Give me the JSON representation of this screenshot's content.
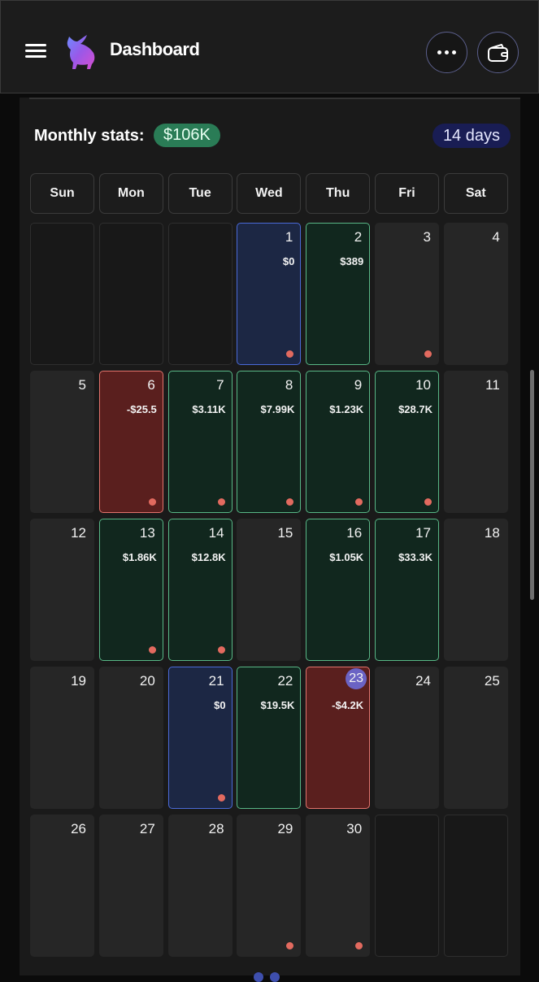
{
  "header": {
    "title": "Dashboard",
    "icons": {
      "menu": "hamburger-icon",
      "logo": "bull-logo",
      "more": "more-horizontal-icon",
      "wallet": "wallet-icon"
    }
  },
  "stats": {
    "label": "Monthly stats:",
    "total": "$106K",
    "days": "14 days"
  },
  "colors": {
    "profit": "#58b786",
    "loss": "#e3736c",
    "neutral": "#4a6ad8",
    "stats_badge": "#2a7c56",
    "days_badge": "#191d54",
    "today_circle": "#6b63c4",
    "marker_dot": "#e26a5f"
  },
  "calendar": {
    "weekdays": [
      "Sun",
      "Mon",
      "Tue",
      "Wed",
      "Thu",
      "Fri",
      "Sat"
    ],
    "cells": [
      {
        "day": "",
        "status": "empty",
        "amount": "",
        "dot": false
      },
      {
        "day": "",
        "status": "empty",
        "amount": "",
        "dot": false
      },
      {
        "day": "",
        "status": "empty",
        "amount": "",
        "dot": false
      },
      {
        "day": "1",
        "status": "neutral",
        "amount": "$0",
        "dot": true
      },
      {
        "day": "2",
        "status": "profit",
        "amount": "$389",
        "dot": false
      },
      {
        "day": "3",
        "status": "none",
        "amount": "",
        "dot": true
      },
      {
        "day": "4",
        "status": "none",
        "amount": "",
        "dot": false
      },
      {
        "day": "5",
        "status": "none",
        "amount": "",
        "dot": false
      },
      {
        "day": "6",
        "status": "loss",
        "amount": "-$25.5",
        "dot": true
      },
      {
        "day": "7",
        "status": "profit",
        "amount": "$3.11K",
        "dot": true
      },
      {
        "day": "8",
        "status": "profit",
        "amount": "$7.99K",
        "dot": true
      },
      {
        "day": "9",
        "status": "profit",
        "amount": "$1.23K",
        "dot": true
      },
      {
        "day": "10",
        "status": "profit",
        "amount": "$28.7K",
        "dot": true
      },
      {
        "day": "11",
        "status": "none",
        "amount": "",
        "dot": false
      },
      {
        "day": "12",
        "status": "none",
        "amount": "",
        "dot": false
      },
      {
        "day": "13",
        "status": "profit",
        "amount": "$1.86K",
        "dot": true
      },
      {
        "day": "14",
        "status": "profit",
        "amount": "$12.8K",
        "dot": true
      },
      {
        "day": "15",
        "status": "none",
        "amount": "",
        "dot": false
      },
      {
        "day": "16",
        "status": "profit",
        "amount": "$1.05K",
        "dot": false
      },
      {
        "day": "17",
        "status": "profit",
        "amount": "$33.3K",
        "dot": false
      },
      {
        "day": "18",
        "status": "none",
        "amount": "",
        "dot": false
      },
      {
        "day": "19",
        "status": "none",
        "amount": "",
        "dot": false
      },
      {
        "day": "20",
        "status": "none",
        "amount": "",
        "dot": false
      },
      {
        "day": "21",
        "status": "neutral",
        "amount": "$0",
        "dot": true
      },
      {
        "day": "22",
        "status": "profit",
        "amount": "$19.5K",
        "dot": false
      },
      {
        "day": "23",
        "status": "loss",
        "amount": "-$4.2K",
        "dot": false,
        "today": true
      },
      {
        "day": "24",
        "status": "none",
        "amount": "",
        "dot": false
      },
      {
        "day": "25",
        "status": "none",
        "amount": "",
        "dot": false
      },
      {
        "day": "26",
        "status": "none",
        "amount": "",
        "dot": false
      },
      {
        "day": "27",
        "status": "none",
        "amount": "",
        "dot": false
      },
      {
        "day": "28",
        "status": "none",
        "amount": "",
        "dot": false
      },
      {
        "day": "29",
        "status": "none",
        "amount": "",
        "dot": true
      },
      {
        "day": "30",
        "status": "none",
        "amount": "",
        "dot": true
      },
      {
        "day": "",
        "status": "empty",
        "amount": "",
        "dot": false
      },
      {
        "day": "",
        "status": "empty",
        "amount": "",
        "dot": false
      }
    ]
  }
}
